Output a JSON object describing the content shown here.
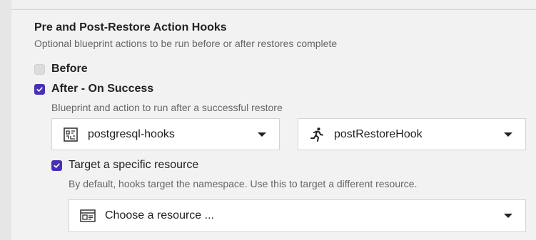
{
  "hooks_section": {
    "title": "Pre and Post-Restore Action Hooks",
    "description": "Optional blueprint actions to be run before or after restores complete"
  },
  "before_option": {
    "label": "Before",
    "checked": false
  },
  "after_option": {
    "label": "After - On Success",
    "checked": true,
    "description": "Blueprint and action to run after a successful restore",
    "blueprint_select": {
      "value": "postgresql-hooks",
      "icon": "blueprint-icon"
    },
    "action_select": {
      "value": "postRestoreHook",
      "icon": "running-person-icon"
    }
  },
  "target_option": {
    "label": "Target a specific resource",
    "checked": true,
    "description": "By default, hooks target the namespace. Use this to target a different resource.",
    "resource_select": {
      "placeholder": "Choose a resource ...",
      "icon": "resource-window-icon"
    }
  },
  "colors": {
    "accent": "#4a2fb5",
    "background": "#f2f2f2",
    "muted_text": "#666666"
  }
}
